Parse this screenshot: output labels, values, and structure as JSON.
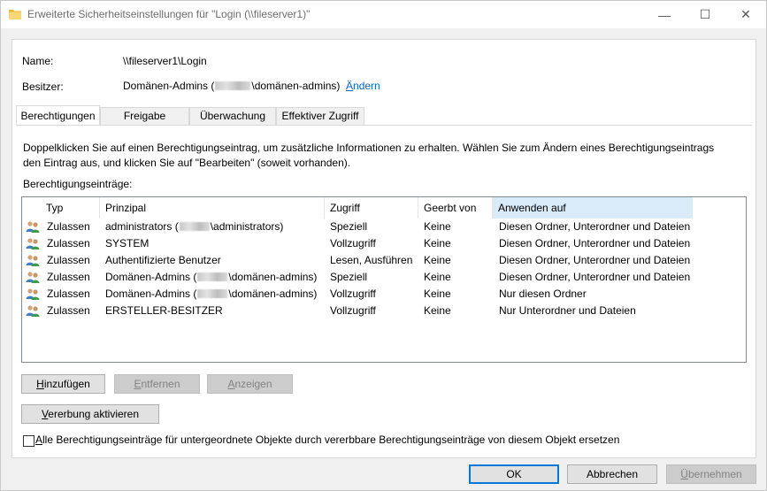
{
  "window": {
    "title": "Erweiterte Sicherheitseinstellungen für \"Login (\\\\fileserver1)\"",
    "controls": {
      "minimize": "—",
      "maximize": "☐",
      "close": "✕"
    }
  },
  "info": {
    "name_label": "Name:",
    "name_value": "\\\\fileserver1\\Login",
    "owner_label": "Besitzer:",
    "owner_value_pre": "Domänen-Admins (",
    "owner_value_post": "\\domänen-admins)",
    "change_link_first": "Ä",
    "change_link_rest": "ndern"
  },
  "tabs": [
    "Berechtigungen",
    "Freigabe",
    "Überwachung",
    "Effektiver Zugriff"
  ],
  "description": "Doppelklicken Sie auf einen Berechtigungseintrag, um zusätzliche Informationen zu erhalten. Wählen Sie zum Ändern eines Berechtigungseintrags den Eintrag aus, und klicken Sie auf \"Bearbeiten\" (soweit vorhanden).",
  "entries_label": "Berechtigungseinträge:",
  "table": {
    "headers": [
      "Typ",
      "Prinzipal",
      "Zugriff",
      "Geerbt von",
      "Anwenden auf"
    ],
    "rows": [
      {
        "typ": "Zulassen",
        "principal_pre": "administrators (",
        "principal_post": "\\administrators)",
        "redacted": true,
        "zugriff": "Speziell",
        "geerbt": "Keine",
        "anwenden": "Diesen Ordner, Unterordner und Dateien"
      },
      {
        "typ": "Zulassen",
        "principal_pre": "SYSTEM",
        "principal_post": "",
        "redacted": false,
        "zugriff": "Vollzugriff",
        "geerbt": "Keine",
        "anwenden": "Diesen Ordner, Unterordner und Dateien"
      },
      {
        "typ": "Zulassen",
        "principal_pre": "Authentifizierte Benutzer",
        "principal_post": "",
        "redacted": false,
        "zugriff": "Lesen, Ausführen",
        "geerbt": "Keine",
        "anwenden": "Diesen Ordner, Unterordner und Dateien"
      },
      {
        "typ": "Zulassen",
        "principal_pre": "Domänen-Admins (",
        "principal_post": "\\domänen-admins)",
        "redacted": true,
        "zugriff": "Speziell",
        "geerbt": "Keine",
        "anwenden": "Diesen Ordner, Unterordner und Dateien"
      },
      {
        "typ": "Zulassen",
        "principal_pre": "Domänen-Admins (",
        "principal_post": "\\domänen-admins)",
        "redacted": true,
        "zugriff": "Vollzugriff",
        "geerbt": "Keine",
        "anwenden": "Nur diesen Ordner"
      },
      {
        "typ": "Zulassen",
        "principal_pre": "ERSTELLER-BESITZER",
        "principal_post": "",
        "redacted": false,
        "zugriff": "Vollzugriff",
        "geerbt": "Keine",
        "anwenden": "Nur Unterordner und Dateien"
      }
    ]
  },
  "buttons": {
    "add": {
      "u": "H",
      "rest": "inzufügen"
    },
    "remove": {
      "u": "E",
      "rest": "ntfernen"
    },
    "view": {
      "u": "A",
      "rest": "nzeigen"
    },
    "inherit": {
      "u": "V",
      "rest": "ererbung aktivieren"
    },
    "ok": "OK",
    "cancel": "Abbrechen",
    "apply": {
      "u": "Ü",
      "rest": "bernehmen"
    }
  },
  "checkbox": {
    "u": "A",
    "rest": "lle Berechtigungseinträge für untergeordnete Objekte durch vererbbare Berechtigungseinträge von diesem Objekt ersetzen",
    "checked": false
  },
  "icons": {
    "title": "folder-icon",
    "row": "user-group-icon"
  }
}
